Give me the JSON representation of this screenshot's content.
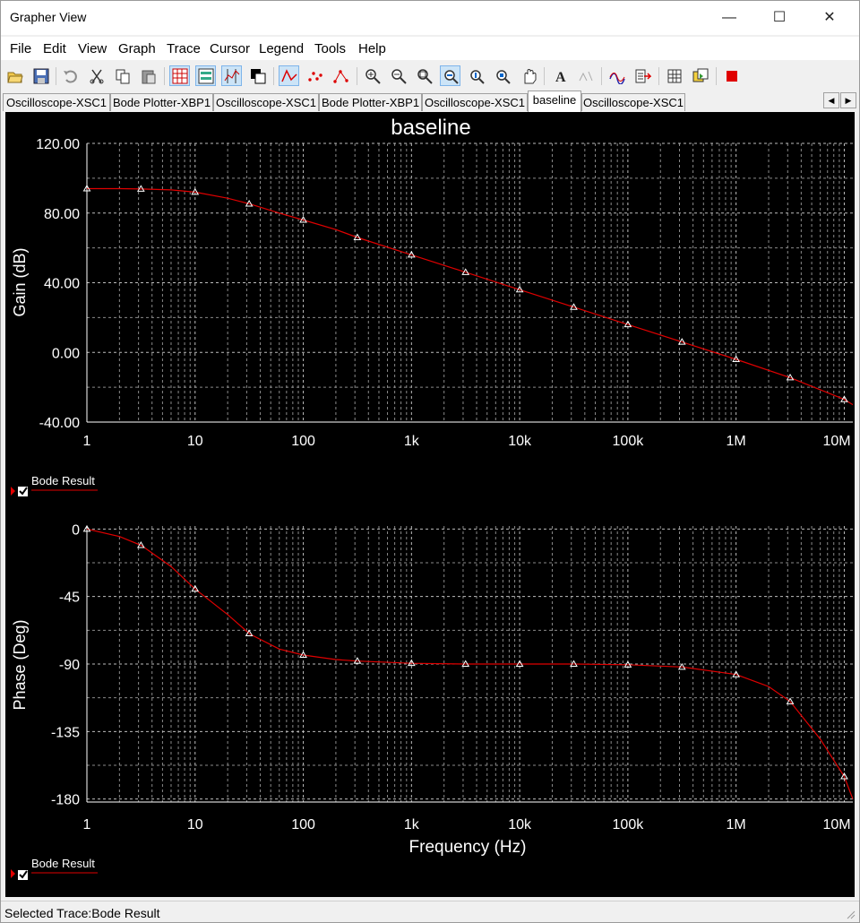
{
  "window": {
    "title": "Grapher View",
    "minimize_glyph": "—",
    "maximize_glyph": "☐",
    "close_glyph": "✕"
  },
  "menu": [
    "File",
    "Edit",
    "View",
    "Graph",
    "Trace",
    "Cursor",
    "Legend",
    "Tools",
    "Help"
  ],
  "toolbar": [
    {
      "name": "open-icon"
    },
    {
      "name": "save-icon"
    },
    {
      "name": "undo-icon"
    },
    {
      "name": "cut-icon"
    },
    {
      "name": "copy-icon"
    },
    {
      "name": "paste-icon"
    },
    {
      "name": "grid-icon"
    },
    {
      "name": "legend-icon"
    },
    {
      "name": "cursors-icon"
    },
    {
      "name": "reverse-colors-icon"
    },
    {
      "name": "lines-icon"
    },
    {
      "name": "points-icon"
    },
    {
      "name": "lines-points-icon"
    },
    {
      "name": "zoom-in-icon"
    },
    {
      "name": "zoom-out-icon"
    },
    {
      "name": "zoom-full-icon"
    },
    {
      "name": "zoom-x-icon"
    },
    {
      "name": "zoom-y-icon"
    },
    {
      "name": "zoom-area-icon"
    },
    {
      "name": "pan-icon"
    },
    {
      "name": "text-icon"
    },
    {
      "name": "title-icon"
    },
    {
      "name": "trace-properties-icon"
    },
    {
      "name": "export-icon"
    },
    {
      "name": "copy-graph-icon"
    },
    {
      "name": "overlay-icon"
    },
    {
      "name": "stop-icon"
    }
  ],
  "tabs": [
    "Oscilloscope-XSC1",
    "Bode Plotter-XBP1",
    "Oscilloscope-XSC1",
    "Bode Plotter-XBP1",
    "Oscilloscope-XSC1",
    "baseline",
    "Oscilloscope-XSC1"
  ],
  "active_tab": 5,
  "tab_scroll": {
    "left": "◀",
    "right": "▶"
  },
  "graph": {
    "title": "baseline",
    "legend_label": "Bode Result",
    "trace_color": "#e00000",
    "background": "#000000"
  },
  "status": {
    "text": "Selected Trace:Bode Result"
  },
  "chart_data": [
    {
      "type": "line",
      "title": "baseline",
      "xlabel": "",
      "ylabel": "Gain (dB)",
      "xscale": "log",
      "xlim": [
        1,
        12000000
      ],
      "ylim": [
        -40,
        120
      ],
      "xticks": [
        1,
        10,
        100,
        1000,
        10000,
        100000,
        1000000,
        10000000
      ],
      "xticklabels": [
        "1",
        "10",
        "100",
        "1k",
        "10k",
        "100k",
        "1M",
        "10M"
      ],
      "yticks": [
        -40,
        0,
        40,
        80,
        120
      ],
      "yticklabels": [
        "-40.00",
        "0.00",
        "40.00",
        "80.00",
        "120.00"
      ],
      "grid": true,
      "legend": "bottom-left",
      "series": [
        {
          "name": "Bode Result",
          "x": [
            1,
            2,
            3.2,
            6,
            10,
            20,
            32,
            60,
            100,
            200,
            316,
            1000,
            3162,
            10000,
            31623,
            100000,
            316228,
            1000000,
            3162278,
            10000000,
            12000000
          ],
          "y": [
            94.0,
            94.0,
            93.8,
            93.3,
            92.0,
            88.5,
            85.2,
            80.0,
            76.0,
            70.5,
            66.0,
            56.0,
            46.0,
            36.0,
            26.0,
            16.0,
            6.0,
            -4.0,
            -14.5,
            -27.0,
            -30.0
          ]
        }
      ],
      "markers_x": [
        1,
        3.16,
        10,
        31.6,
        100,
        316,
        1000,
        3162,
        10000,
        31623,
        100000,
        316228,
        1000000,
        3162278,
        10000000
      ]
    },
    {
      "type": "line",
      "title": "",
      "xlabel": "Frequency (Hz)",
      "ylabel": "Phase (Deg)",
      "xscale": "log",
      "xlim": [
        1,
        12000000
      ],
      "ylim": [
        -182,
        2
      ],
      "xticks": [
        1,
        10,
        100,
        1000,
        10000,
        100000,
        1000000,
        10000000
      ],
      "xticklabels": [
        "1",
        "10",
        "100",
        "1k",
        "10k",
        "100k",
        "1M",
        "10M"
      ],
      "yticks": [
        -180,
        -135,
        -90,
        -45,
        0
      ],
      "yticklabels": [
        "-180",
        "-135",
        "-90",
        "-45",
        "0"
      ],
      "grid": true,
      "legend": "bottom-left",
      "series": [
        {
          "name": "Bode Result",
          "x": [
            1,
            2,
            3.2,
            6,
            10,
            20,
            32,
            60,
            100,
            200,
            316,
            1000,
            3162,
            10000,
            31623,
            100000,
            316228,
            1000000,
            2000000,
            3162278,
            6000000,
            10000000,
            12000000
          ],
          "y": [
            0,
            -5,
            -11,
            -25,
            -40,
            -57,
            -70,
            -80,
            -84,
            -87,
            -88,
            -89.5,
            -90,
            -90,
            -90,
            -90.5,
            -92,
            -97,
            -105,
            -115,
            -140,
            -165,
            -180
          ]
        }
      ],
      "markers_x": [
        1,
        3.16,
        10,
        31.6,
        100,
        316,
        1000,
        3162,
        10000,
        31623,
        100000,
        316228,
        1000000,
        3162278,
        10000000
      ]
    }
  ]
}
